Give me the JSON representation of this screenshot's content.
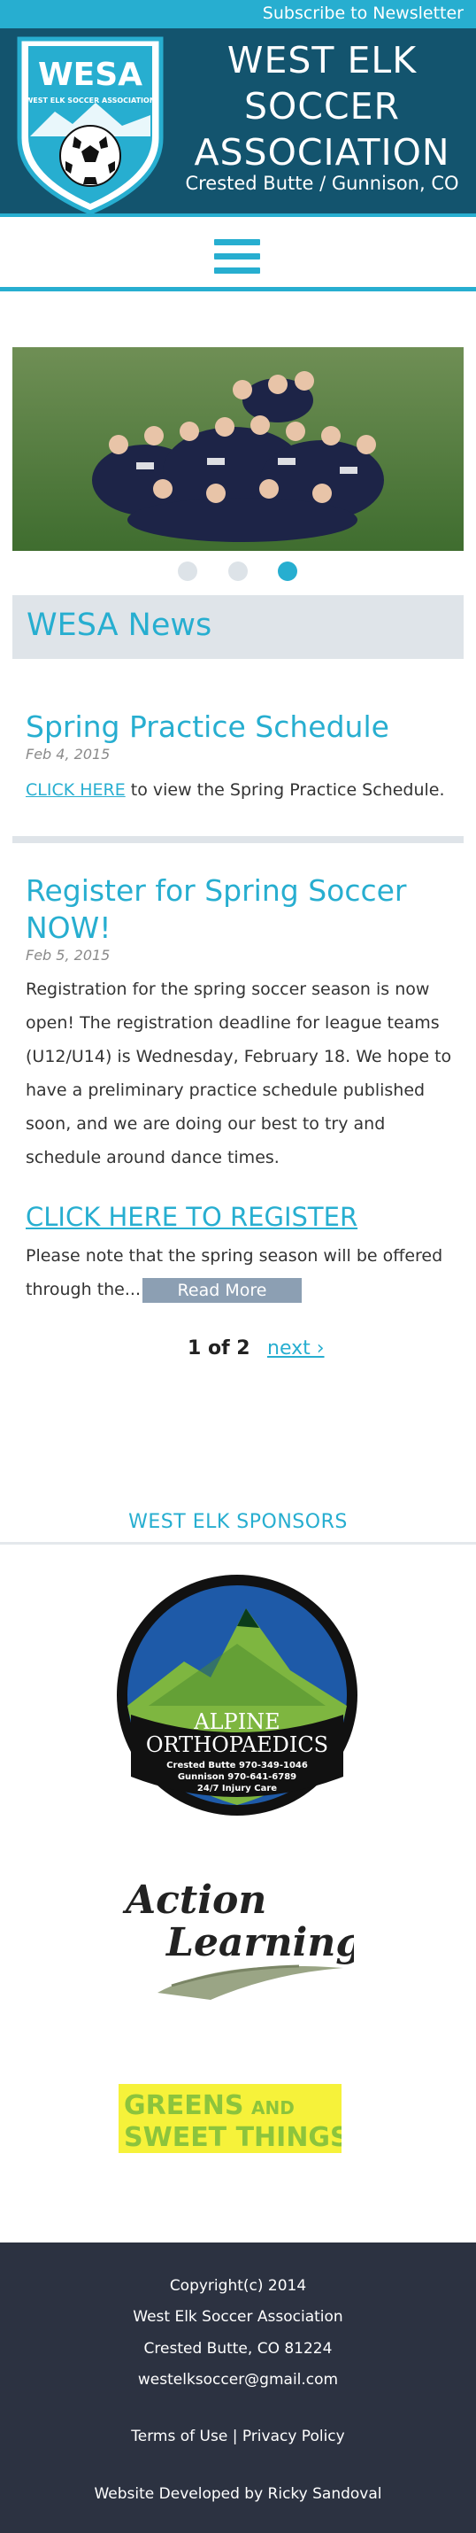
{
  "topbar": {
    "subscribe_label": "Subscribe to Newsletter"
  },
  "header": {
    "logo_text": "WESA",
    "logo_ring_text": "WEST ELK SOCCER ASSOCIATION",
    "title_line1": "WEST ELK",
    "title_line2": "SOCCER",
    "title_line3": "ASSOCIATION",
    "subtitle": "Crested Butte / Gunnison, CO"
  },
  "nav": {
    "menu_icon": "hamburger-menu-icon"
  },
  "slider": {
    "image": "team-photo",
    "dots": 3,
    "active_dot": 3
  },
  "news": {
    "heading": "WESA News",
    "posts": [
      {
        "title": "Spring Practice Schedule",
        "date": "Feb 4, 2015",
        "link_text": "CLICK HERE",
        "body": " to view the Spring Practice Schedule."
      },
      {
        "title_line1": "Register for Spring Soccer",
        "title_line2": "NOW!",
        "date": "Feb 5, 2015",
        "body": "Registration for the spring soccer season is now open! The registration deadline for league teams (U12/U14) is Wednesday, February 18. We hope to have a preliminary practice schedule published soon, and we are doing our best to try and schedule around dance times.",
        "register_link": "CLICK HERE TO REGISTER",
        "excerpt_line1": "Please note that the spring season will be offered",
        "excerpt_line2": "through the...",
        "read_more_label": "Read More"
      }
    ]
  },
  "pager": {
    "current": "1 of 2",
    "next_label": "next ›"
  },
  "sponsors": {
    "heading": "WEST ELK SPONSORS",
    "alpine": {
      "line1": "ALPINE",
      "line2": "ORTHOPAEDICS",
      "phone1": "Crested Butte 970-349-1046",
      "phone2": "Gunnison 970-641-6789",
      "tagline": "24/7 Injury Care"
    },
    "action": {
      "line1": "Action",
      "line2": "Learning"
    },
    "greens": {
      "line1a": "GREENS",
      "line1b": "AND",
      "line2": "SWEET THINGS"
    }
  },
  "footer": {
    "copyright": "Copyright(c) 2014",
    "org": "West Elk Soccer Association",
    "address": "Crested Butte, CO 81224",
    "email": "westelksoccer@gmail.com",
    "terms": "Terms of Use",
    "separator": "|",
    "privacy": "Privacy Policy",
    "credit": "Website Developed by Ricky Sandoval"
  },
  "colors": {
    "accent": "#27aed0",
    "header_bg": "#13546e",
    "footer_bg": "#2c3241",
    "panel_bg": "#dfe4e9",
    "button_bg": "#8c9fb3"
  }
}
